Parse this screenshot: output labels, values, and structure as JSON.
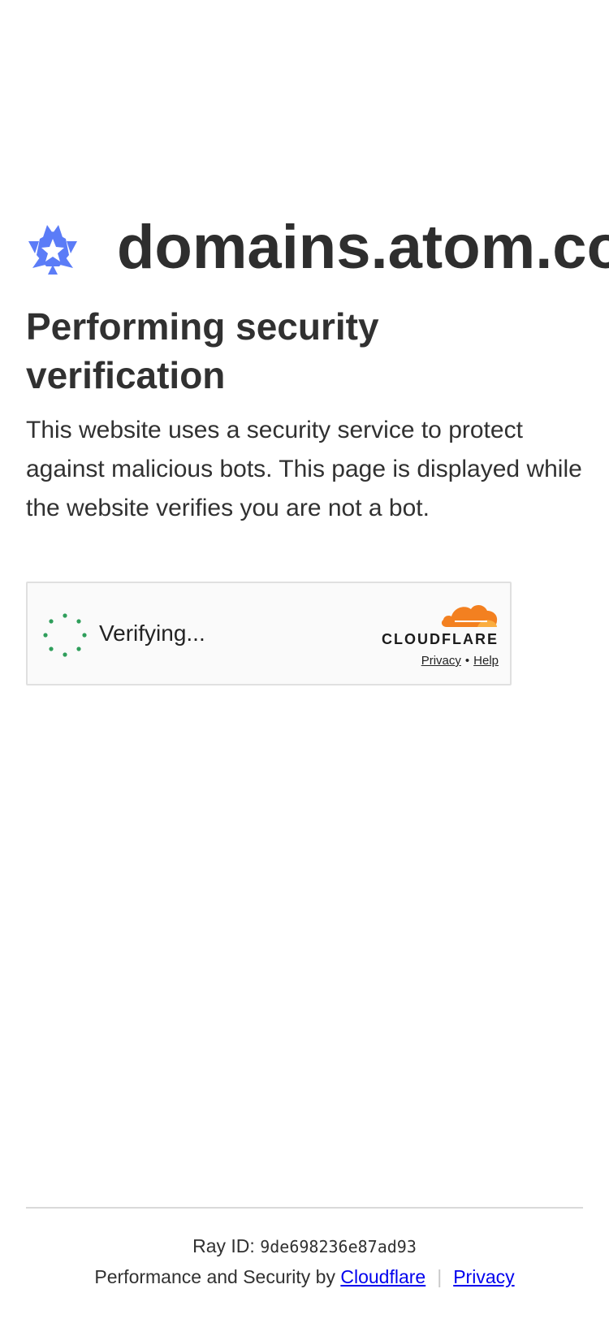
{
  "site": {
    "domain": "domains.atom.com",
    "logo_icon": "atom-star-logo-icon",
    "logo_color": "#5b7cf7"
  },
  "page": {
    "title": "Performing security verification",
    "description": "This website uses a security service to protect against malicious bots. This page is displayed while the website verifies you are not a bot."
  },
  "challenge": {
    "status_label": "Verifying...",
    "spinner_icon": "loading-spinner-icon",
    "spinner_color": "#2f9e5b",
    "brand_wordmark": "CLOUDFLARE",
    "brand_icon": "cloudflare-cloud-icon",
    "brand_color": "#f38020",
    "privacy_label": "Privacy",
    "separator": "•",
    "help_label": "Help"
  },
  "footer": {
    "ray_label": "Ray ID:",
    "ray_id": "9de698236e87ad93",
    "perf_prefix": "Performance and Security by",
    "cloudflare_link": "Cloudflare",
    "divider": "|",
    "privacy_link": "Privacy",
    "link_color": "#0000ee"
  }
}
